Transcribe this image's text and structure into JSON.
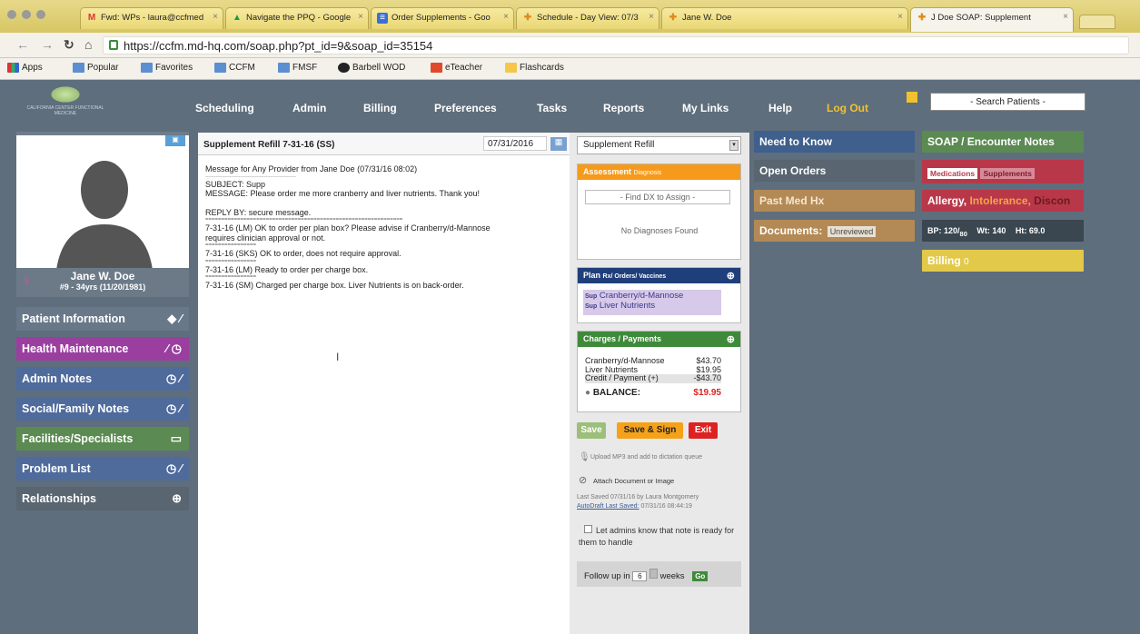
{
  "browser": {
    "tabs": [
      {
        "label": "Fwd: WPs - laura@ccfmed",
        "icon": "M",
        "close": "×"
      },
      {
        "label": "Navigate the PPQ - Google",
        "icon": "▲",
        "close": "×"
      },
      {
        "label": "Order Supplements - Goo",
        "icon": "≡",
        "close": "×"
      },
      {
        "label": "Schedule - Day View: 07/3",
        "icon": "✚",
        "close": "×"
      },
      {
        "label": "Jane W. Doe",
        "icon": "✚",
        "close": "×"
      },
      {
        "label": "J Doe SOAP: Supplement",
        "icon": "✚",
        "close": "×"
      }
    ],
    "url": "https://ccfm.md-hq.com/soap.php?pt_id=9&soap_id=35154",
    "bookmarks": [
      "Apps",
      "Popular",
      "Favorites",
      "CCFM",
      "FMSF",
      "Barbell WOD",
      "eTeacher",
      "Flashcards"
    ]
  },
  "app": {
    "logo_text": "CALIFORNIA CENTER FUNCTIONAL MEDICINE",
    "nav": [
      "Scheduling",
      "Admin",
      "Billing",
      "Preferences",
      "Tasks",
      "Reports",
      "My Links",
      "Help"
    ],
    "logout": "Log Out",
    "search_placeholder": "- Search Patients -"
  },
  "patient": {
    "name": "Jane W. Doe",
    "info": "#9 - 34yrs (11/20/1981)",
    "sections": [
      {
        "label": "Patient Information",
        "color": "#697888"
      },
      {
        "label": "Health Maintenance",
        "color": "#9a3fa0"
      },
      {
        "label": "Admin Notes",
        "color": "#4f6b9c"
      },
      {
        "label": "Social/Family Notes",
        "color": "#4f6b9c"
      },
      {
        "label": "Facilities/Specialists",
        "color": "#5b8a52"
      },
      {
        "label": "Problem List",
        "color": "#4f6b9c"
      },
      {
        "label": "Relationships",
        "color": "#596570"
      }
    ]
  },
  "note": {
    "title": "Supplement Refill 7-31-16 (SS)",
    "date": "07/31/2016",
    "type": "Supplement Refill",
    "lines": [
      "Message for Any Provider from Jane Doe (07/31/16 08:02)",
      "------------------------------------------------------------",
      "SUBJECT: Supp",
      "MESSAGE: Please order me more cranberry and liver nutrients. Thank you!",
      "",
      "REPLY BY: secure message.",
      "==============================================================",
      "7-31-16 (LM) OK to order per plan box? Please advise if Cranberry/d-Mannose",
      "requires clinician approval or not.",
      "================",
      "7-31-16 (SKS) OK to order, does not require approval.",
      "================",
      "7-31-16 (LM) Ready to order per charge box.",
      "================",
      "7-31-16 (SM) Charged per charge box. Liver Nutrients is on back-order."
    ]
  },
  "assessment": {
    "title": "Assessment",
    "sub": "Diagnosis",
    "find": "- Find DX to Assign -",
    "empty": "No Diagnoses Found"
  },
  "plan": {
    "title": "Plan",
    "sub": "Rx/ Orders/ Vaccines",
    "items": [
      {
        "tag": "Sup",
        "name": "Cranberry/d-Mannose"
      },
      {
        "tag": "Sup",
        "name": "Liver Nutrients"
      }
    ]
  },
  "charges": {
    "title": "Charges / Payments",
    "items": [
      {
        "name": "Cranberry/d-Mannose",
        "amt": "$43.70"
      },
      {
        "name": "Liver Nutrients",
        "amt": "$19.95"
      },
      {
        "name": "Credit / Payment (+)",
        "amt": "-$43.70"
      }
    ],
    "balance_label": "BALANCE:",
    "balance": "$19.95"
  },
  "actions": {
    "save": "Save",
    "save_sign": "Save & Sign",
    "exit": "Exit",
    "upload": "Upload MP3 and add to dictation queue",
    "attach": "Attach Document or Image",
    "last_saved": "Last Saved 07/31/16 by Laura Montgomery",
    "autodraft": "AutoDraft Last Saved:",
    "autodraft_time": "07/31/16 08:44:19",
    "notify": "Let admins know that note is ready for them to handle",
    "follow_up": "Follow up in",
    "follow_num": "6",
    "follow_unit": "weeks",
    "go": "Go"
  },
  "right1": {
    "need": "Need to Know",
    "orders": "Open Orders",
    "pmh": "Past Med Hx",
    "docs": "Documents:",
    "docs_sel": "Unreviewed"
  },
  "right2": {
    "soap": "SOAP / Encounter Notes",
    "meds": "Medications",
    "supps": "Supplements",
    "allergy": "Allergy,",
    "intolerance": "Intolerance,",
    "discon": "Discon",
    "bp": "BP: 120/",
    "bp2": "80",
    "wt": "Wt: 140",
    "ht": "Ht: 69.0",
    "billing": "Billing",
    "billing_count": "0"
  }
}
